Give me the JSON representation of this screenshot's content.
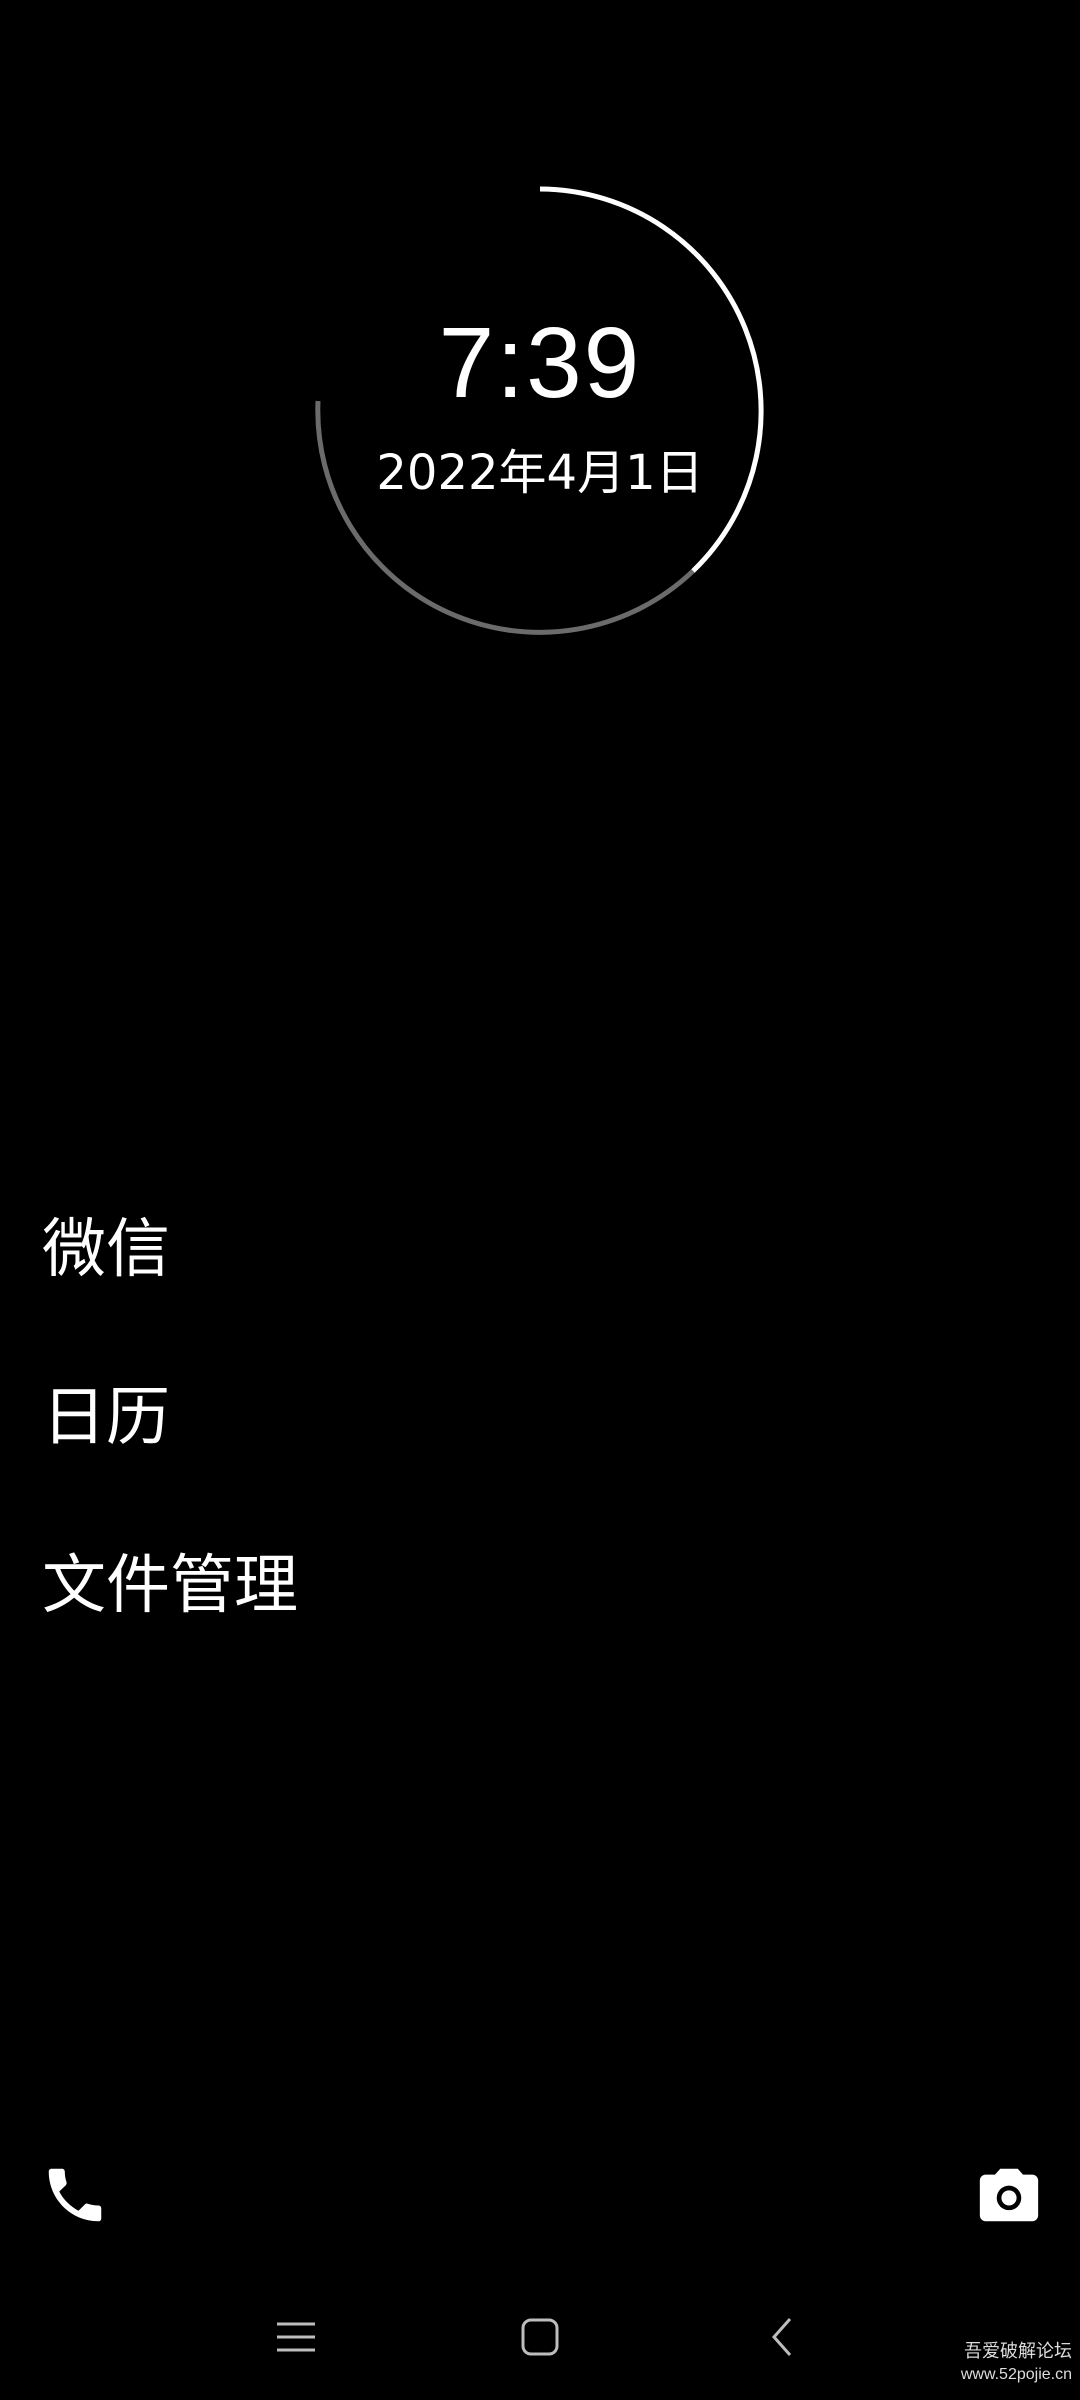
{
  "clock": {
    "time": "7:39",
    "date": "2022年4月1日",
    "ring_bright_color": "#ffffff",
    "ring_dim_color": "#6b6b6b"
  },
  "apps": [
    {
      "label": "微信"
    },
    {
      "label": "日历"
    },
    {
      "label": "文件管理"
    }
  ],
  "shortcuts": {
    "left_icon": "phone-icon",
    "right_icon": "camera-icon"
  },
  "nav": {
    "items": [
      "menu-icon",
      "home-icon",
      "back-icon"
    ]
  },
  "watermark": {
    "name": "吾爱破解论坛",
    "url": "www.52pojie.cn"
  }
}
